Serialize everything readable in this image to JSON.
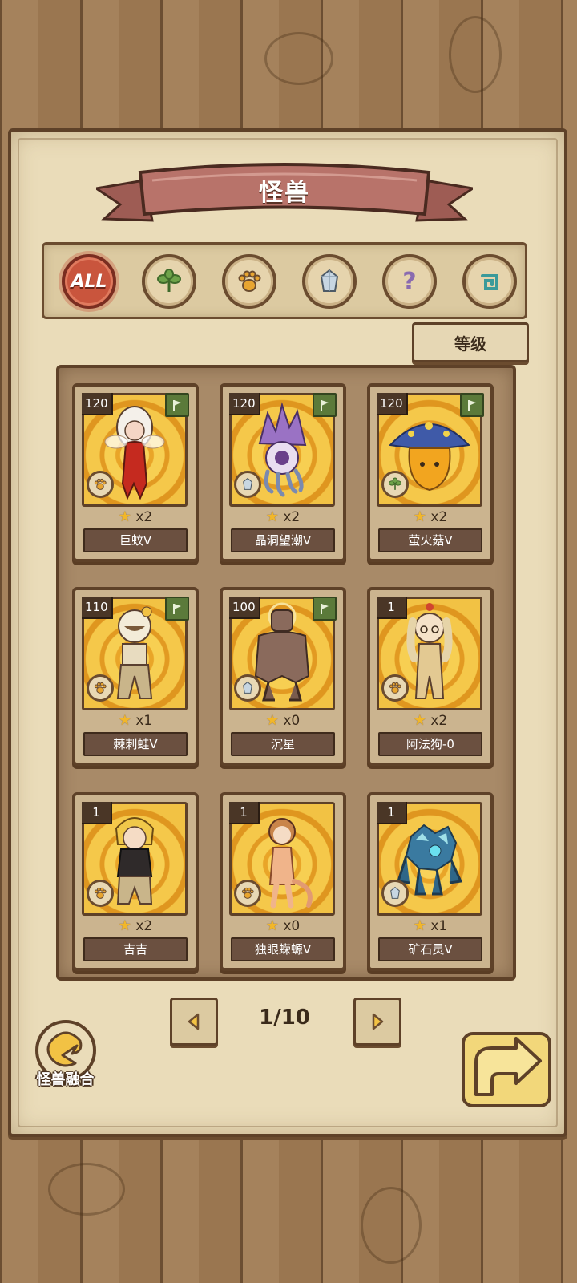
{
  "header": {
    "title": "怪兽"
  },
  "categories": [
    {
      "id": "all",
      "label": "ALL",
      "icon": "all-icon",
      "active": true
    },
    {
      "id": "plant",
      "icon": "leaf-icon"
    },
    {
      "id": "beast",
      "icon": "paw-icon"
    },
    {
      "id": "mineral",
      "icon": "crystal-icon"
    },
    {
      "id": "unknown",
      "icon": "question-icon"
    },
    {
      "id": "special",
      "icon": "spiral-icon"
    }
  ],
  "sort": {
    "label": "等级"
  },
  "monsters": [
    {
      "level": "120",
      "stars": "x2",
      "name": "巨蚊V",
      "type": "paw-icon",
      "flag": true,
      "art": "mosquito-girl"
    },
    {
      "level": "120",
      "stars": "x2",
      "name": "晶洞望潮V",
      "type": "crystal-icon",
      "flag": true,
      "art": "crystal-octopus"
    },
    {
      "level": "120",
      "stars": "x2",
      "name": "萤火菇V",
      "type": "leaf-icon",
      "flag": true,
      "art": "glow-mushroom"
    },
    {
      "level": "110",
      "stars": "x1",
      "name": "棘刺蛙V",
      "type": "paw-icon",
      "flag": true,
      "art": "spike-frog"
    },
    {
      "level": "100",
      "stars": "x0",
      "name": "沉星",
      "type": "crystal-icon",
      "flag": true,
      "art": "stone-golem"
    },
    {
      "level": "1",
      "stars": "x2",
      "name": "阿法狗-0",
      "type": "paw-icon",
      "flag": false,
      "art": "dog-girl"
    },
    {
      "level": "1",
      "stars": "x2",
      "name": "吉吉",
      "type": "paw-icon",
      "flag": false,
      "art": "monkey-boy"
    },
    {
      "level": "1",
      "stars": "x0",
      "name": "独眼蝾螈V",
      "type": "paw-icon",
      "flag": false,
      "art": "salamander-girl"
    },
    {
      "level": "1",
      "stars": "x1",
      "name": "矿石灵V",
      "type": "crystal-icon",
      "flag": false,
      "art": "ore-spirit"
    }
  ],
  "pagination": {
    "text": "1/10"
  },
  "fusion": {
    "label": "怪兽融合"
  },
  "colors": {
    "paper": "#eadcb9",
    "outline": "#5e4128",
    "banner": "#b8736a",
    "active_category": "#c9553d",
    "card_art_gold": "#f5c84a"
  }
}
